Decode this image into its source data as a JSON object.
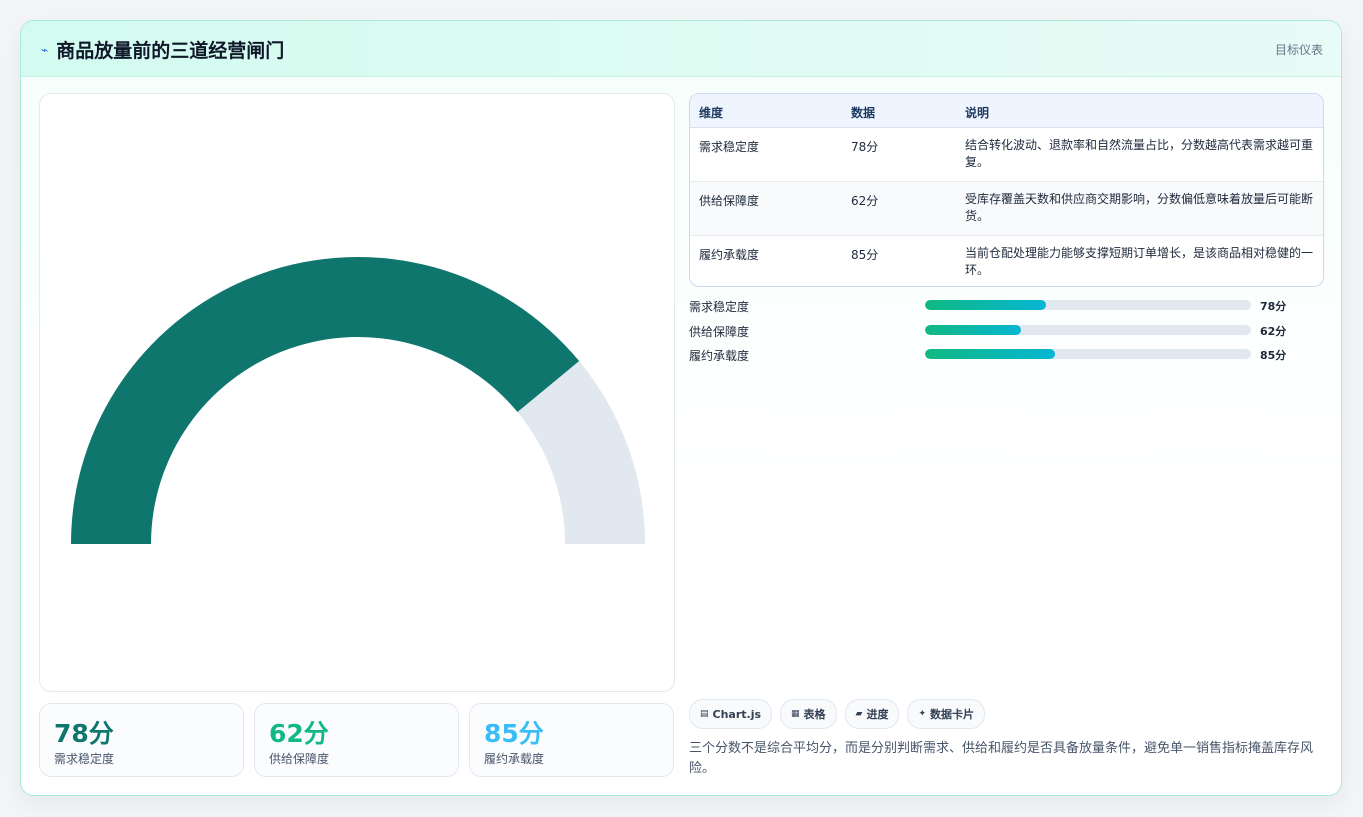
{
  "header": {
    "icon": "bolt-icon",
    "title": "商品放量前的三道经营闸门",
    "tag": "目标仪表"
  },
  "chart_data": {
    "type": "gauge",
    "value": 78,
    "max": 100,
    "colors": {
      "filled": "#0f766e",
      "track": "#e2e8f0"
    }
  },
  "kpis": [
    {
      "value": "78分",
      "label": "需求稳定度",
      "color": "#0f766e"
    },
    {
      "value": "62分",
      "label": "供给保障度",
      "color": "#10b981"
    },
    {
      "value": "85分",
      "label": "履约承载度",
      "color": "#38bdf8"
    }
  ],
  "table": {
    "headers": [
      "维度",
      "数据",
      "说明"
    ],
    "rows": [
      {
        "dim": "需求稳定度",
        "data": "78分",
        "desc": "结合转化波动、退款率和自然流量占比，分数越高代表需求越可重复。"
      },
      {
        "dim": "供给保障度",
        "data": "62分",
        "desc": "受库存覆盖天数和供应商交期影响，分数偏低意味着放量后可能断货。"
      },
      {
        "dim": "履约承载度",
        "data": "85分",
        "desc": "当前仓配处理能力能够支撑短期订单增长，是该商品相对稳健的一环。"
      }
    ]
  },
  "bars": [
    {
      "label": "需求稳定度",
      "value": "78分",
      "fill": 0.37
    },
    {
      "label": "供给保障度",
      "value": "62分",
      "fill": 0.295
    },
    {
      "label": "履约承载度",
      "value": "85分",
      "fill": 0.4
    }
  ],
  "chips": [
    {
      "icon": "chart-icon",
      "glyph": "▤",
      "label": "Chart.js"
    },
    {
      "icon": "table-icon",
      "glyph": "▦",
      "label": "表格"
    },
    {
      "icon": "progress-icon",
      "glyph": "▰",
      "label": "进度"
    },
    {
      "icon": "card-icon",
      "glyph": "✦",
      "label": "数据卡片"
    }
  ],
  "note": "三个分数不是综合平均分，而是分别判断需求、供给和履约是否具备放量条件，避免单一销售指标掩盖库存风险。"
}
